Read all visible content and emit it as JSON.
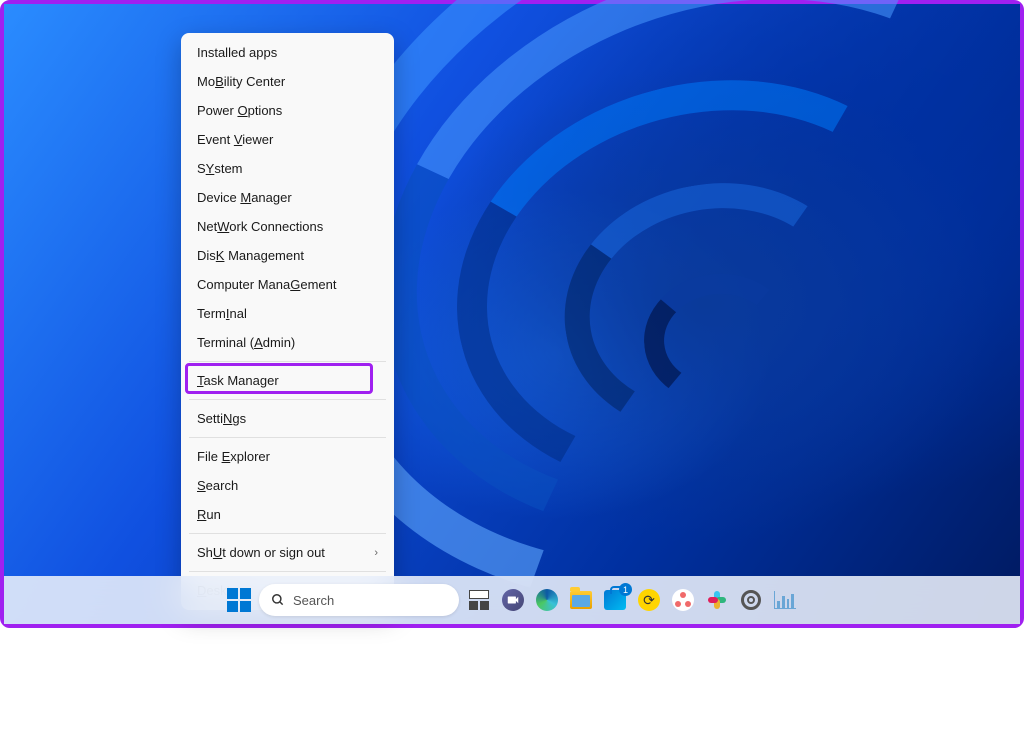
{
  "menu": {
    "items": [
      {
        "label": "Installed apps",
        "plain": true
      },
      {
        "label": "Mobility Center",
        "key": "B",
        "pre": "Mo",
        "post": "ility Center"
      },
      {
        "label": "Power Options",
        "key": "O",
        "pre": "Power ",
        "post": "ptions"
      },
      {
        "label": "Event Viewer",
        "key": "V",
        "pre": "Event ",
        "post": "iewer"
      },
      {
        "label": "System",
        "key": "Y",
        "pre": "S",
        "post": "stem"
      },
      {
        "label": "Device Manager",
        "key": "M",
        "pre": "Device ",
        "post": "anager"
      },
      {
        "label": "Network Connections",
        "key": "W",
        "pre": "Net",
        "post": "ork Connections"
      },
      {
        "label": "Disk Management",
        "key": "K",
        "pre": "Dis",
        "post": " Management"
      },
      {
        "label": "Computer Management",
        "key": "G",
        "pre": "Computer Mana",
        "post": "ement"
      },
      {
        "label": "Terminal",
        "key": "I",
        "pre": "Term",
        "post": "nal"
      },
      {
        "label": "Terminal (Admin)",
        "key": "A",
        "pre": "Terminal (",
        "post": "dmin)"
      },
      {
        "sep": true
      },
      {
        "label": "Task Manager",
        "key": "T",
        "pre": "",
        "post": "ask Manager",
        "highlighted": true
      },
      {
        "sep": true
      },
      {
        "label": "Settings",
        "key": "N",
        "pre": "Setti",
        "post": "gs"
      },
      {
        "sep": true
      },
      {
        "label": "File Explorer",
        "key": "E",
        "pre": "File ",
        "post": "xplorer"
      },
      {
        "label": "Search",
        "key": "S",
        "pre": "",
        "post": "earch"
      },
      {
        "label": "Run",
        "key": "R",
        "pre": "",
        "post": "un"
      },
      {
        "sep": true
      },
      {
        "label": "Shut down or sign out",
        "key": "U",
        "pre": "Sh",
        "post": "t down or sign out",
        "submenu": true
      },
      {
        "sep": true
      },
      {
        "label": "Desktop",
        "key": "D",
        "pre": "",
        "post": "esktop"
      }
    ]
  },
  "taskbar": {
    "search_placeholder": "Search",
    "store_badge": "1"
  }
}
